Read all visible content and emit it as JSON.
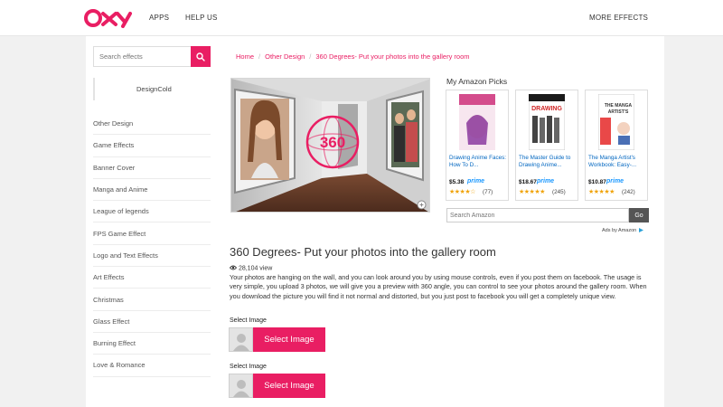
{
  "header": {
    "logo_text": "Oxy",
    "nav": [
      {
        "label": "APPS"
      },
      {
        "label": "HELP US"
      }
    ],
    "more_effects": "MORE EFFECTS"
  },
  "sidebar": {
    "search_placeholder": "Search effects",
    "username": "DesignCold",
    "categories": [
      {
        "label": "Other Design"
      },
      {
        "label": "Game Effects"
      },
      {
        "label": "Banner Cover"
      },
      {
        "label": "Manga and Anime"
      },
      {
        "label": "League of legends"
      },
      {
        "label": "FPS Game Effect"
      },
      {
        "label": "Logo and Text Effects"
      },
      {
        "label": "Art Effects"
      },
      {
        "label": "Christmas"
      },
      {
        "label": "Glass Effect"
      },
      {
        "label": "Burning Effect"
      },
      {
        "label": "Love & Romance"
      }
    ]
  },
  "breadcrumb": [
    "Home",
    "Other Design",
    "360 Degrees- Put your photos into the gallery room"
  ],
  "preview": {
    "badge": "360"
  },
  "amazon": {
    "title": "My Amazon Picks",
    "books": [
      {
        "title": "Drawing Anime Faces: How To D...",
        "price": "$5.38",
        "prime": "prime",
        "stars": "★★★★☆",
        "reviews": "(77)"
      },
      {
        "title": "The Master Guide to Drawing Anime...",
        "price": "$18.67",
        "prime": "prime",
        "stars": "★★★★★",
        "reviews": "(245)"
      },
      {
        "title": "The Manga Artist's Workbook: Easy-...",
        "price": "$10.87",
        "prime": "prime",
        "stars": "★★★★★",
        "reviews": "(242)"
      }
    ],
    "search_placeholder": "Search Amazon",
    "go_label": "Go",
    "ads_by": "Ads by Amazon"
  },
  "main": {
    "title": "360 Degrees- Put your photos into the gallery room",
    "views": "28,104 view",
    "description": "Your photos are hanging on the wall, and you can look around you by using mouse controls, even if you post them on facebook. The usage is very simple, you upload 3 photos, we will give you a preview with 360 angle, you can control to see your photos around the gallery room. When you download the picture you will find it not normal and distorted, but you just post to facebook you will get a completely unique view.",
    "selectors": [
      {
        "label": "Select Image",
        "button": "Select Image"
      },
      {
        "label": "Select Image",
        "button": "Select Image"
      }
    ]
  },
  "colors": {
    "accent": "#e91e63",
    "link": "#0066c0",
    "prime": "#1a98ff"
  }
}
